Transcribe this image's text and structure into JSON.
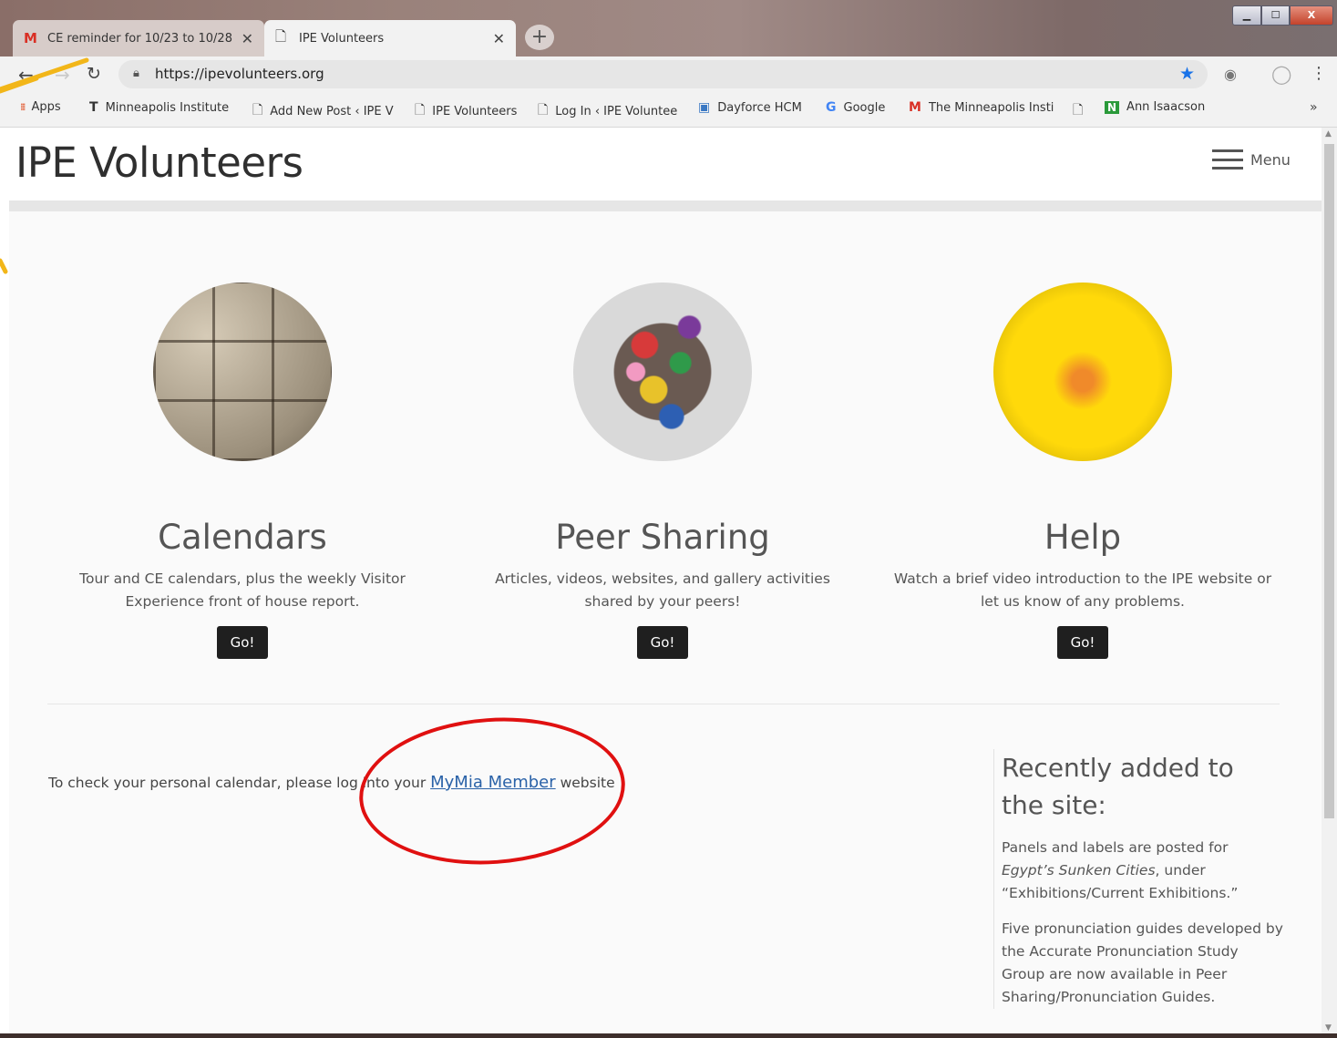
{
  "browser": {
    "tabs": [
      {
        "icon": "gmail-icon",
        "label": "CE reminder for 10/23 to 10/28 -",
        "close": "✕"
      },
      {
        "icon": "page-icon",
        "label": "IPE Volunteers",
        "close": "✕"
      }
    ],
    "new_tab": "+",
    "window_controls": {
      "minimize": "▁",
      "maximize": "☐",
      "close": "X"
    },
    "url": "https://ipevolunteers.org",
    "bookmarks": [
      {
        "icon": "⋮⋮⋮",
        "label": "Apps"
      },
      {
        "icon": "T",
        "label": "Minneapolis Institute"
      },
      {
        "icon": "🗋",
        "label": "Add New Post ‹ IPE V"
      },
      {
        "icon": "🗋",
        "label": "IPE Volunteers"
      },
      {
        "icon": "🗋",
        "label": "Log In ‹ IPE Voluntee"
      },
      {
        "icon": "▣",
        "label": "Dayforce HCM"
      },
      {
        "icon": "G",
        "label": "Google"
      },
      {
        "icon": "M",
        "label": "The Minneapolis Insti"
      },
      {
        "icon": "🗋",
        "label": ""
      },
      {
        "icon": "N",
        "label": "Ann Isaacson"
      }
    ],
    "bookmarks_more": "»",
    "accent": "#1a73e8"
  },
  "site": {
    "title": "IPE Volunteers",
    "menu_label": "Menu",
    "columns": [
      {
        "heading": "Calendars",
        "description": "Tour and CE calendars, plus the weekly Visitor Experience front of house report.",
        "button": "Go!"
      },
      {
        "heading": "Peer Sharing",
        "description": "Articles, videos, websites, and gallery activities shared by your peers!",
        "button": "Go!"
      },
      {
        "heading": "Help",
        "description": "Watch a brief video introduction to the IPE website or let us know of any problems.",
        "button": "Go!"
      }
    ],
    "calendar_note": {
      "before": "To check your personal calendar, please log into your ",
      "link": "MyMia Member",
      "after": " website"
    },
    "sidebar": {
      "heading": "Recently added to the site:",
      "item1": {
        "before": "Panels and labels are posted for ",
        "italic": "Egypt’s Sunken Cities",
        "after": ", under “Exhibitions/Current Exhibitions.”"
      },
      "item2": "Five pronunciation guides developed by the Accurate Pronunciation Study Group are now available in Peer Sharing/Pronunciation Guides."
    },
    "annotation_color": "#e01010",
    "link_color": "#2a62a8"
  }
}
